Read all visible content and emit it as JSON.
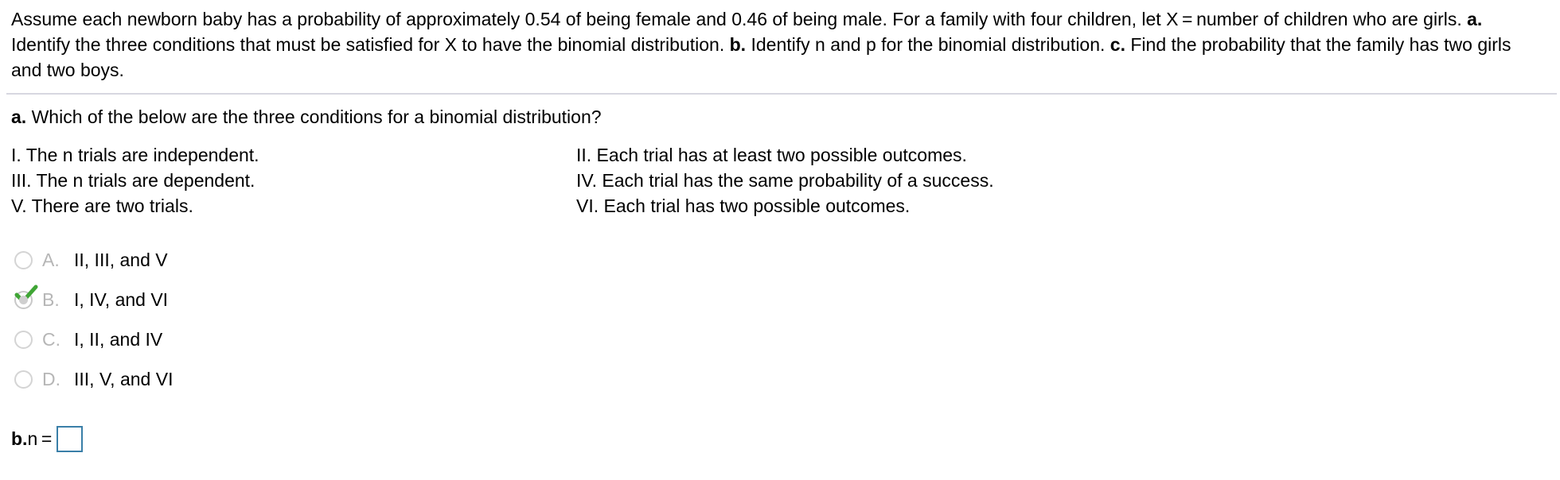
{
  "problem": {
    "part1": "Assume each newborn baby has a probability of approximately 0.54 of being female and 0.46 of being male. For a family with four children, let X = number of children who are girls. ",
    "a_label": "a.",
    "a_text": " Identify the three conditions that must be satisfied for X to have the binomial distribution. ",
    "b_label": "b.",
    "b_text": " Identify n and p for the binomial distribution. ",
    "c_label": "c.",
    "c_text": " Find the probability that the family has two girls and two boys."
  },
  "question_a": {
    "label": "a.",
    "text": " Which of the below are the three conditions for a binomial distribution?"
  },
  "conditions": {
    "c1": "I. The n trials are independent.",
    "c2": "II. Each trial has at least two possible outcomes.",
    "c3": "III. The n trials are dependent.",
    "c4": "IV. Each trial has the same probability of a success.",
    "c5": "V. There are two trials.",
    "c6": "VI. Each trial has two possible outcomes."
  },
  "choices": [
    {
      "letter": "A.",
      "text": "II, III, and V",
      "selected": false
    },
    {
      "letter": "B.",
      "text": "I, IV, and VI",
      "selected": true
    },
    {
      "letter": "C.",
      "text": "I, II, and IV",
      "selected": false
    },
    {
      "letter": "D.",
      "text": "III, V, and VI",
      "selected": false
    }
  ],
  "colors": {
    "check_mark": "#3fa535",
    "answer_box_border": "#3a7fa8",
    "divider": "#d7d7e0"
  },
  "question_b": {
    "label": "b.",
    "text": " n ="
  }
}
